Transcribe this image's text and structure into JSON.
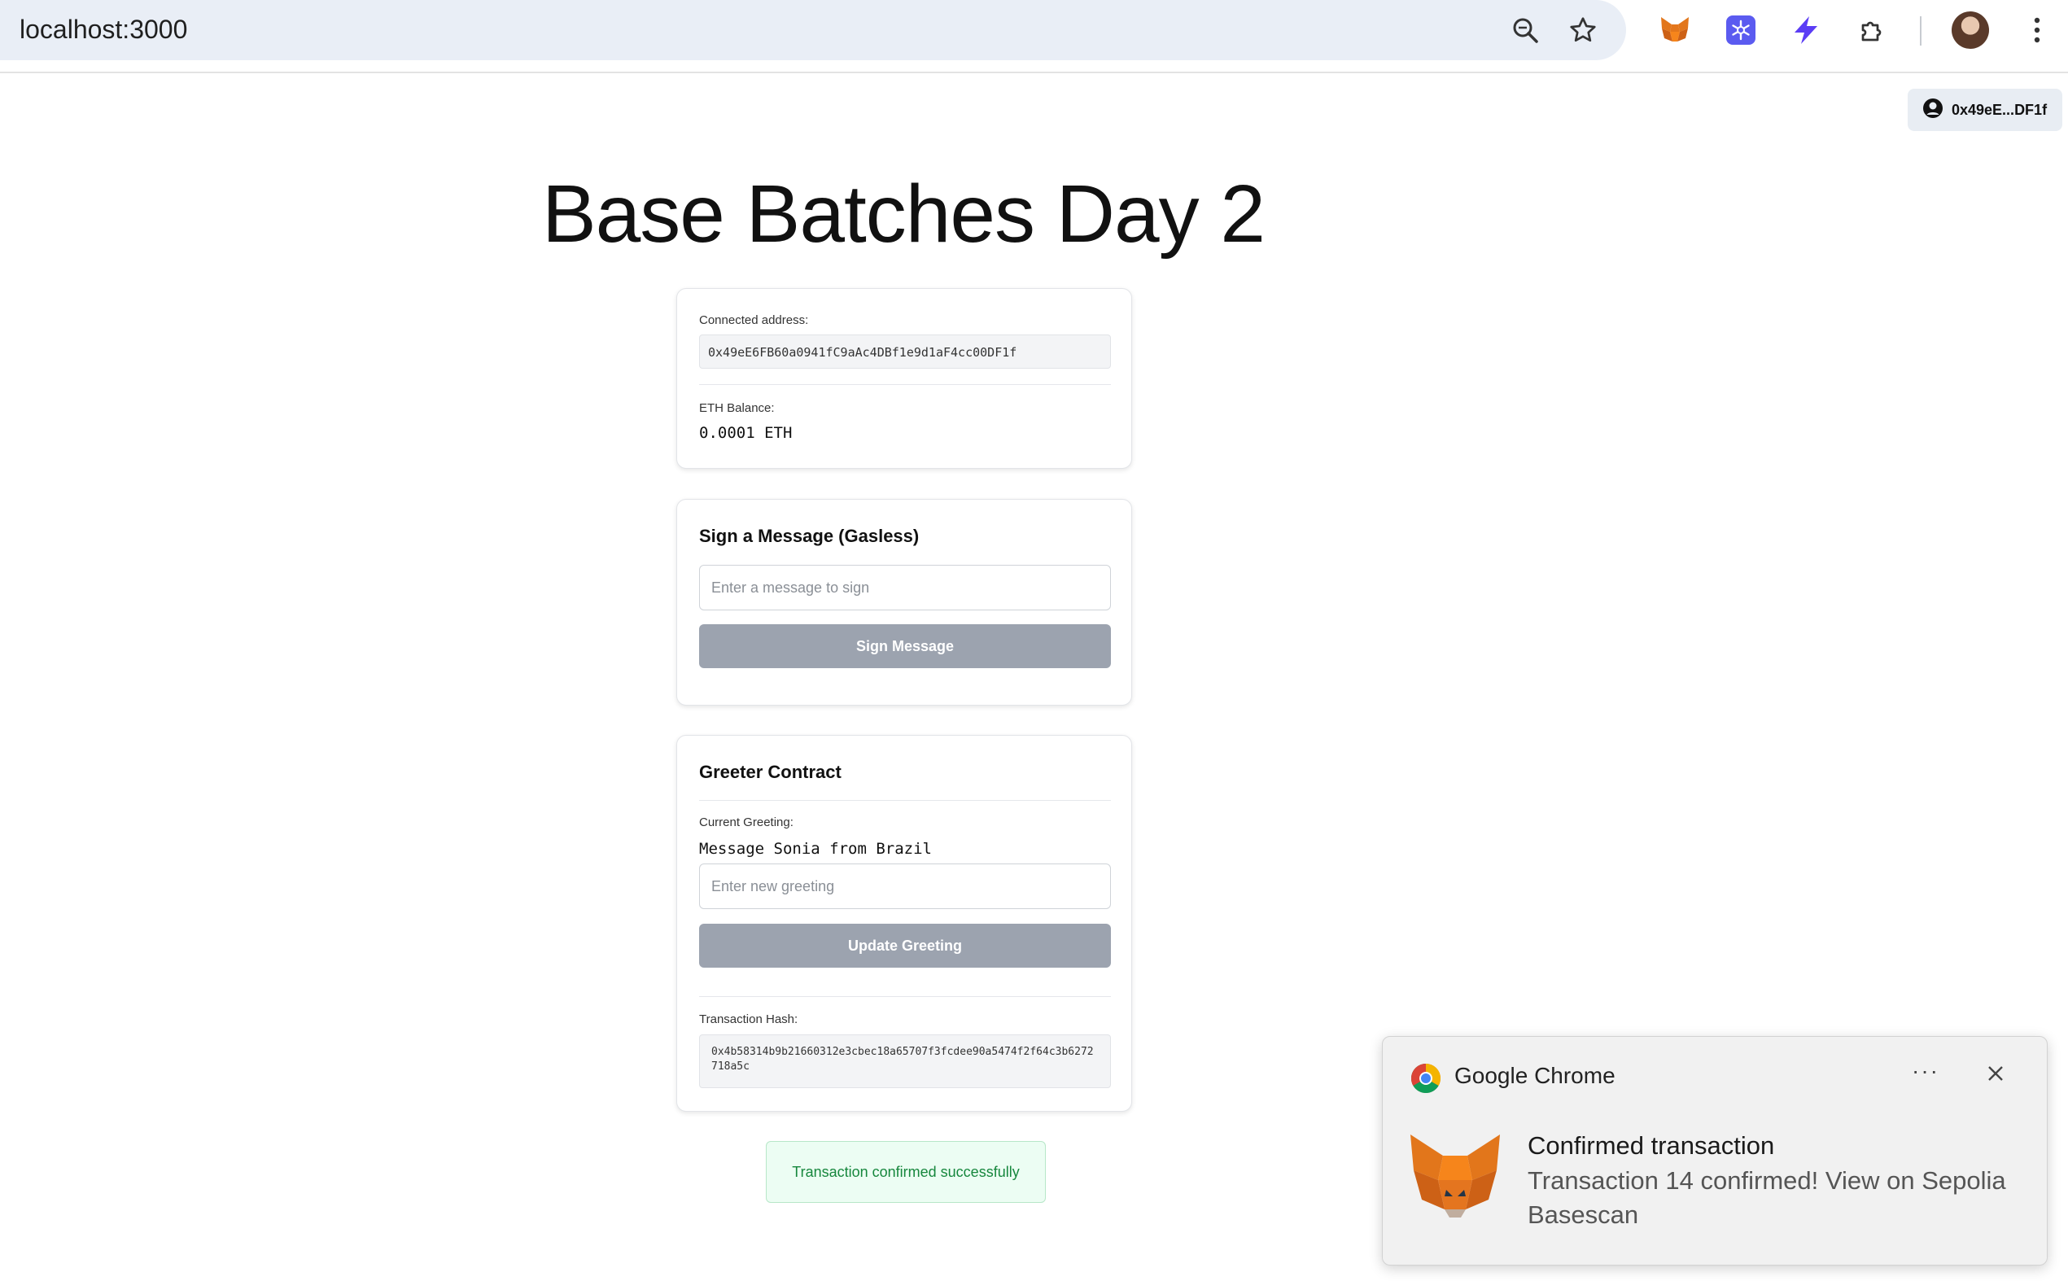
{
  "browser": {
    "url": "localhost:3000",
    "icons": [
      "zoom-icon",
      "bookmark-star-icon",
      "metamask-extension-icon",
      "snowflake-extension-icon",
      "bolt-extension-icon",
      "extensions-puzzle-icon",
      "profile-avatar",
      "menu-kebab-icon"
    ]
  },
  "wallet": {
    "address_short": "0x49eE...DF1f"
  },
  "page": {
    "title": "Base Batches Day 2"
  },
  "account_card": {
    "address_label": "Connected address:",
    "address_value": "0x49eE6FB60a0941fC9aAc4DBf1e9d1aF4cc00DF1f",
    "balance_label": "ETH Balance:",
    "balance_value": "0.0001 ETH"
  },
  "sign_card": {
    "title": "Sign a Message (Gasless)",
    "input_placeholder": "Enter a message to sign",
    "button_label": "Sign Message"
  },
  "greeter_card": {
    "title": "Greeter Contract",
    "current_label": "Current Greeting:",
    "current_value": "Message Sonia from Brazil",
    "input_placeholder": "Enter new greeting",
    "button_label": "Update Greeting",
    "tx_label": "Transaction Hash:",
    "tx_hash": "0x4b58314b9b21660312e3cbec18a65707f3fcdee90a5474f2f64c3b6272718a5c"
  },
  "status": {
    "message": "Transaction confirmed successfully"
  },
  "notification": {
    "app": "Google Chrome",
    "more": "···",
    "title": "Confirmed transaction",
    "body": "Transaction 14 confirmed! View on Sepolia Basescan"
  },
  "colors": {
    "button": "#9ca3af",
    "success_text": "#16873d",
    "success_bg": "#ecfdf3"
  }
}
